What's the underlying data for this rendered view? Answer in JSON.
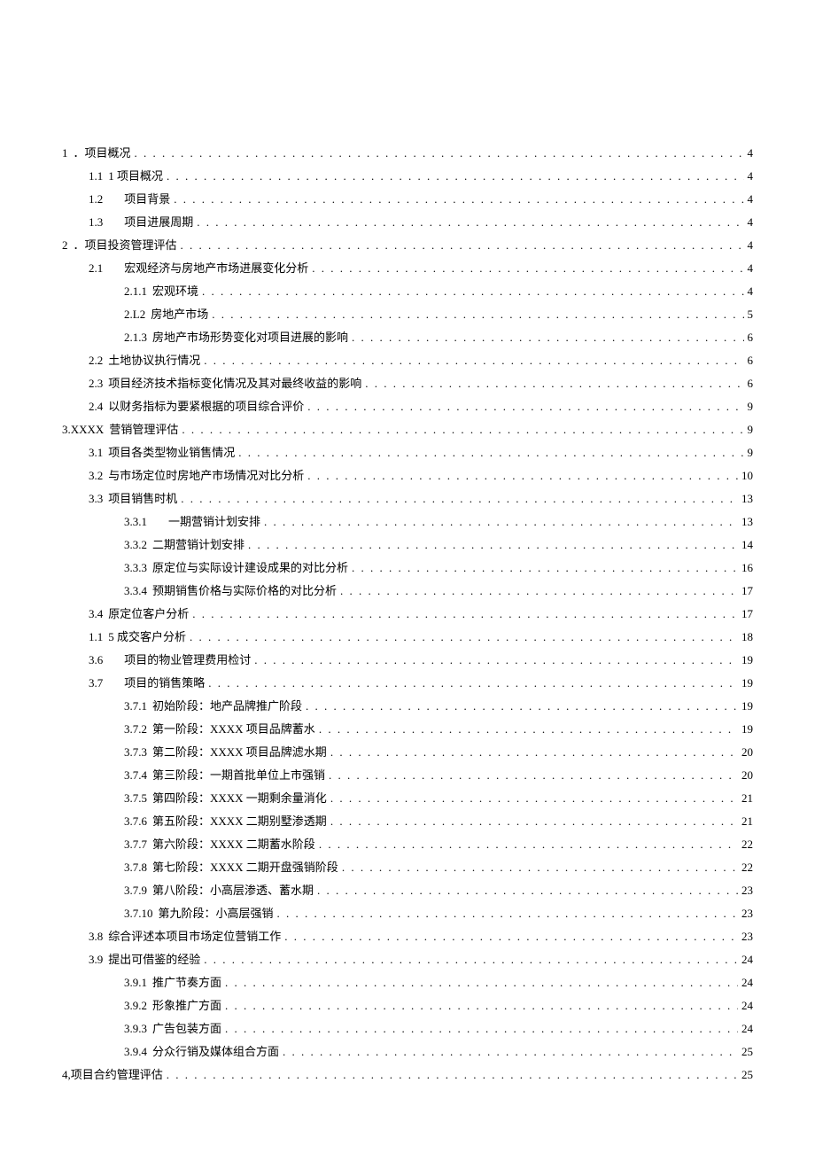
{
  "toc": [
    {
      "level": 1,
      "num": "1",
      "gap": "small",
      "title": "．项目概况",
      "page": "4"
    },
    {
      "level": 2,
      "num": "1.1",
      "gap": "small",
      "title": "1 项目概况",
      "page": "4"
    },
    {
      "level": 2,
      "num": "1.2",
      "gap": "wide",
      "title": "项目背景",
      "page": "4"
    },
    {
      "level": 2,
      "num": "1.3",
      "gap": "wide",
      "title": "项目进展周期",
      "page": "4"
    },
    {
      "level": 1,
      "num": "2",
      "gap": "small",
      "title": "．项目投资管理评估",
      "page": "4"
    },
    {
      "level": 2,
      "num": "2.1",
      "gap": "wide",
      "title": "宏观经济与房地产市场进展变化分析",
      "page": "4"
    },
    {
      "level": 3,
      "num": "2.1.1",
      "gap": "small",
      "title": "宏观环境",
      "page": "4"
    },
    {
      "level": 3,
      "num": "2.L2",
      "gap": "small",
      "title": "房地产市场",
      "page": "5"
    },
    {
      "level": 3,
      "num": "2.1.3",
      "gap": "small",
      "title": "房地产市场形势变化对项目进展的影响",
      "page": "6"
    },
    {
      "level": 2,
      "num": "2.2",
      "gap": "small",
      "title": "土地协议执行情况",
      "page": "6"
    },
    {
      "level": 2,
      "num": "2.3",
      "gap": "small",
      "title": "项目经济技术指标变化情况及其对最终收益的影响",
      "page": "6"
    },
    {
      "level": 2,
      "num": "2.4",
      "gap": "small",
      "title": "以财务指标为要紧根据的项目综合评价",
      "page": "9"
    },
    {
      "level": 1,
      "num": "3.XXXX",
      "gap": "small",
      "title": "营销管理评估",
      "page": "9"
    },
    {
      "level": 2,
      "num": "3.1",
      "gap": "small",
      "title": "项目各类型物业销售情况",
      "page": "9"
    },
    {
      "level": 2,
      "num": "3.2",
      "gap": "small",
      "title": "与市场定位时房地产市场情况对比分析",
      "page": "10"
    },
    {
      "level": 2,
      "num": "3.3",
      "gap": "small",
      "title": "项目销售时机",
      "page": "13"
    },
    {
      "level": 3,
      "num": "3.3.1",
      "gap": "wide",
      "title": "一期营销计划安排",
      "page": "13"
    },
    {
      "level": 3,
      "num": "3.3.2",
      "gap": "small",
      "title": "二期营销计划安排",
      "page": "14"
    },
    {
      "level": 3,
      "num": "3.3.3",
      "gap": "small",
      "title": "原定位与实际设计建设成果的对比分析",
      "page": "16"
    },
    {
      "level": 3,
      "num": "3.3.4",
      "gap": "small",
      "title": "预期销售价格与实际价格的对比分析",
      "page": "17"
    },
    {
      "level": 2,
      "num": "3.4",
      "gap": "small",
      "title": "原定位客户分析",
      "page": "17"
    },
    {
      "level": 2,
      "num": "1.1",
      "gap": "small",
      "title": "5 成交客户分析",
      "page": "18"
    },
    {
      "level": 2,
      "num": "3.6",
      "gap": "wide",
      "title": "项目的物业管理费用检讨",
      "page": "19"
    },
    {
      "level": 2,
      "num": "3.7",
      "gap": "wide",
      "title": "项目的销售策略",
      "page": "19"
    },
    {
      "level": 3,
      "num": "3.7.1",
      "gap": "small",
      "title": "初始阶段：地产品牌推广阶段",
      "page": "19"
    },
    {
      "level": 3,
      "num": "3.7.2",
      "gap": "small",
      "title": "第一阶段：XXXX 项目品牌蓄水",
      "page": "19"
    },
    {
      "level": 3,
      "num": "3.7.3",
      "gap": "small",
      "title": "第二阶段：XXXX 项目品牌滤水期",
      "page": "20"
    },
    {
      "level": 3,
      "num": "3.7.4",
      "gap": "small",
      "title": "第三阶段：一期首批单位上市强销",
      "page": "20"
    },
    {
      "level": 3,
      "num": "3.7.5",
      "gap": "small",
      "title": "第四阶段：XXXX 一期剩余量消化",
      "page": "21"
    },
    {
      "level": 3,
      "num": "3.7.6",
      "gap": "small",
      "title": "第五阶段：XXXX 二期别墅渗透期",
      "page": "21"
    },
    {
      "level": 3,
      "num": "3.7.7",
      "gap": "small",
      "title": "第六阶段：XXXX 二期蓄水阶段",
      "page": "22"
    },
    {
      "level": 3,
      "num": "3.7.8",
      "gap": "small",
      "title": "第七阶段：XXXX 二期开盘强销阶段",
      "page": "22"
    },
    {
      "level": 3,
      "num": "3.7.9",
      "gap": "small",
      "title": "第八阶段：小高层渗透、蓄水期",
      "page": "23"
    },
    {
      "level": 3,
      "num": "3.7.10",
      "gap": "small",
      "title": "第九阶段：小高层强销",
      "page": "23"
    },
    {
      "level": 2,
      "num": "3.8",
      "gap": "small",
      "title": "综合评述本项目市场定位营销工作",
      "page": "23"
    },
    {
      "level": 2,
      "num": "3.9",
      "gap": "small",
      "title": "提出可借鉴的经验",
      "page": "24"
    },
    {
      "level": 3,
      "num": "3.9.1",
      "gap": "small",
      "title": "推广节奏方面",
      "page": "24"
    },
    {
      "level": 3,
      "num": "3.9.2",
      "gap": "small",
      "title": "形象推广方面",
      "page": "24"
    },
    {
      "level": 3,
      "num": "3.9.3",
      "gap": "small",
      "title": "广告包装方面",
      "page": "24"
    },
    {
      "level": 3,
      "num": "3.9.4",
      "gap": "small",
      "title": "分众行销及媒体组合方面",
      "page": "25"
    },
    {
      "level": 1,
      "num": "4,项目合约管理评估",
      "gap": "none",
      "title": "",
      "page": "25"
    }
  ]
}
